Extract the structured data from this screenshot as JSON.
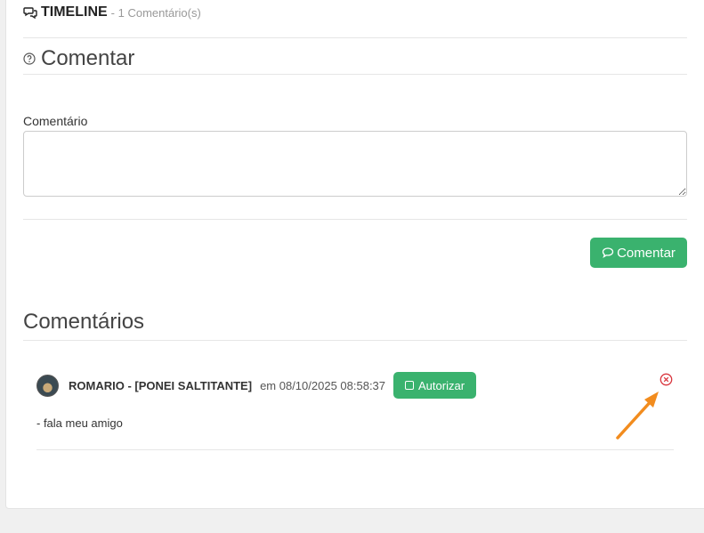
{
  "timeline": {
    "title": "TIMELINE",
    "count": "- 1 Comentário(s)"
  },
  "comment_form": {
    "heading": "Comentar",
    "field_label": "Comentário",
    "field_value": "",
    "submit_label": "Comentar"
  },
  "comments_section": {
    "heading": "Comentários",
    "items": [
      {
        "author": "ROMARIO - [PONEI SALTITANTE]",
        "when": "em 08/10/2025 08:58:37",
        "authorize_label": "Autorizar",
        "text": "- fala meu amigo"
      }
    ]
  },
  "colors": {
    "accent_green": "#3ab26e",
    "delete_red": "#d9363e",
    "annotation_orange": "#f28c1e"
  },
  "icons": {
    "timeline": "comments-icon",
    "help": "question-circle-icon",
    "submit": "comment-icon",
    "authorize": "square-icon",
    "delete": "times-circle-icon"
  }
}
